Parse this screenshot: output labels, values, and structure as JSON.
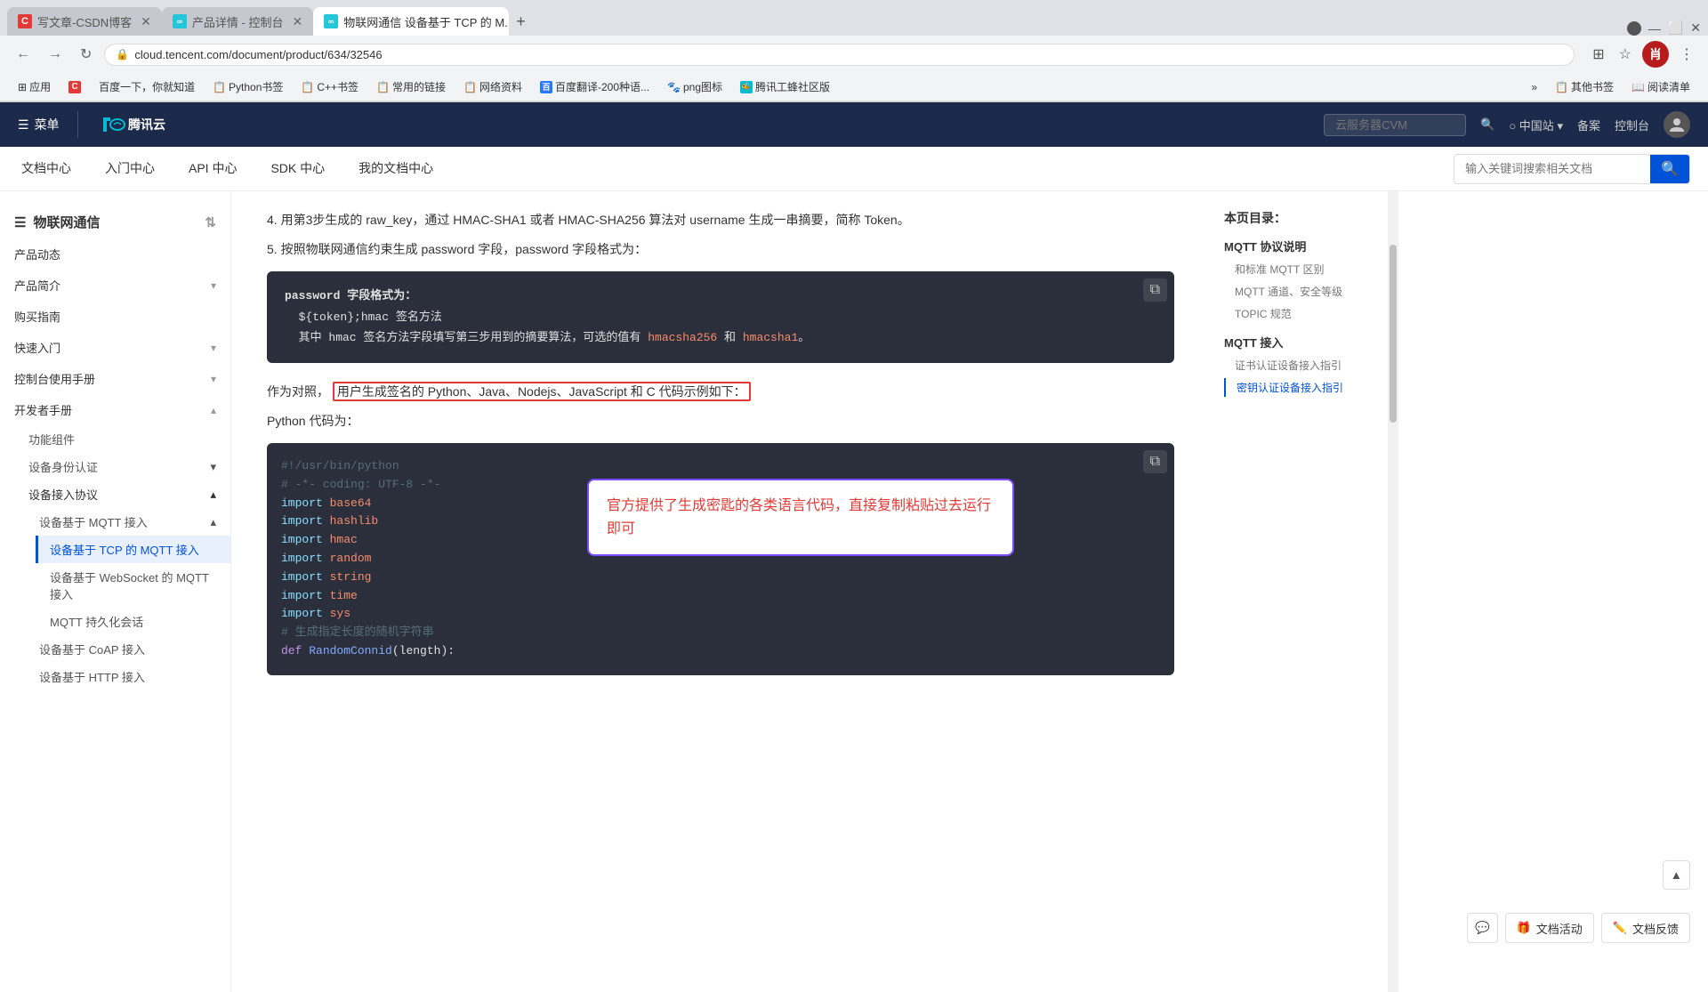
{
  "browser": {
    "tabs": [
      {
        "id": "tab1",
        "label": "写文章-CSDN博客",
        "icon_color": "#e53935",
        "icon_text": "C",
        "active": false
      },
      {
        "id": "tab2",
        "label": "产品详情 - 控制台",
        "icon_color": "#00bcd4",
        "icon_text": "∞",
        "active": false
      },
      {
        "id": "tab3",
        "label": "物联网通信 设备基于 TCP 的 M...",
        "icon_color": "#00bcd4",
        "icon_text": "∞",
        "active": true
      }
    ],
    "new_tab_label": "+",
    "address": "cloud.tencent.com/document/product/634/32546",
    "lock_icon": "🔒"
  },
  "bookmarks": [
    {
      "label": "应用",
      "icon": "⊞"
    },
    {
      "label": "百度一下，你就知道",
      "icon": "B"
    },
    {
      "label": "Python书签",
      "icon": "📋"
    },
    {
      "label": "C++书签",
      "icon": "📋"
    },
    {
      "label": "常用的链接",
      "icon": "📋"
    },
    {
      "label": "网络资料",
      "icon": "📋"
    },
    {
      "label": "百度翻译-200种语...",
      "icon": "百"
    },
    {
      "label": "png图标",
      "icon": "🐾"
    },
    {
      "label": "腾讯工蜂社区版",
      "icon": "🐝"
    },
    {
      "label": "»",
      "icon": ""
    },
    {
      "label": "其他书签",
      "icon": "📋"
    },
    {
      "label": "阅读清单",
      "icon": "📖"
    }
  ],
  "tc_header": {
    "menu_label": "菜单",
    "logo_text": "腾讯云",
    "search_placeholder": "云服务器CVM",
    "search_icon": "🔍",
    "region_label": "中国站",
    "backup_label": "备案",
    "console_label": "控制台"
  },
  "doc_nav": {
    "items": [
      {
        "label": "文档中心"
      },
      {
        "label": "入门中心"
      },
      {
        "label": "API 中心"
      },
      {
        "label": "SDK 中心"
      },
      {
        "label": "我的文档中心"
      }
    ],
    "search_placeholder": "输入关键词搜索相关文档"
  },
  "sidebar": {
    "title": "物联网通信",
    "items": [
      {
        "label": "产品动态",
        "expandable": false
      },
      {
        "label": "产品简介",
        "expandable": true
      },
      {
        "label": "购买指南",
        "expandable": false
      },
      {
        "label": "快速入门",
        "expandable": true
      },
      {
        "label": "控制台使用手册",
        "expandable": true
      },
      {
        "label": "开发者手册",
        "expandable": true,
        "expanded": true,
        "children": [
          {
            "label": "功能组件"
          },
          {
            "label": "设备身份认证",
            "expandable": true
          },
          {
            "label": "设备接入协议",
            "expandable": true,
            "expanded": true,
            "children": [
              {
                "label": "设备基于 MQTT 接入",
                "expandable": true,
                "expanded": true,
                "children": [
                  {
                    "label": "设备基于 TCP 的 MQTT 接入",
                    "active": true
                  },
                  {
                    "label": "设备基于 WebSocket 的 MQTT 接入"
                  },
                  {
                    "label": "MQTT 持久化会话"
                  }
                ]
              },
              {
                "label": "设备基于 CoAP 接入"
              },
              {
                "label": "设备基于 HTTP 接入"
              }
            ]
          }
        ]
      }
    ]
  },
  "content": {
    "step4": "4. 用第3步生成的 raw_key，通过 HMAC-SHA1 或者 HMAC-SHA256 算法对 username 生成一串摘要，简称 Token。",
    "step5": "5. 按照物联网通信约束生成 password 字段，password 字段格式为：",
    "password_block": {
      "title": "password 字段格式为：",
      "line1": "${token};hmac 签名方法",
      "line2": "其中 hmac 签名方法字段填写第三步用到的摘要算法，可选的值有 hmacsha256 和 hmacsha1。"
    },
    "comparison_text": "作为对照，",
    "highlight_text": "用户生成签名的 Python、Java、Nodejs、JavaScript 和 C 代码示例如下：",
    "python_label": "Python 代码为：",
    "callout_text": "官方提供了生成密匙的各类语言代码，直接复制粘贴过去运行即可",
    "code_lines": [
      {
        "text": "#!/usr/bin/python",
        "type": "comment"
      },
      {
        "text": "# -*- coding: UTF-8 -*-",
        "type": "comment"
      },
      {
        "text": "import base64",
        "type": "import"
      },
      {
        "text": "import hashlib",
        "type": "import"
      },
      {
        "text": "import hmac",
        "type": "import"
      },
      {
        "text": "import random",
        "type": "import"
      },
      {
        "text": "import string",
        "type": "import"
      },
      {
        "text": "import time",
        "type": "import"
      },
      {
        "text": "import sys",
        "type": "import"
      },
      {
        "text": "# 生成指定长度的随机字符串",
        "type": "comment"
      },
      {
        "text": "def RandomConnid(length):",
        "type": "func"
      }
    ]
  },
  "right_toc": {
    "title": "本页目录：",
    "sections": [
      {
        "label": "MQTT 协议说明",
        "children": [
          {
            "label": "和标准 MQTT 区别"
          },
          {
            "label": "MQTT 通道、安全等级"
          },
          {
            "label": "TOPIC 规范"
          }
        ]
      },
      {
        "label": "MQTT 接入",
        "children": [
          {
            "label": "证书认证设备接入指引"
          },
          {
            "label": "密钥认证设备接入指引",
            "active": true
          }
        ]
      }
    ]
  },
  "bottom_actions": {
    "doc_activity_label": "文档活动",
    "doc_feedback_label": "文档反馈"
  }
}
